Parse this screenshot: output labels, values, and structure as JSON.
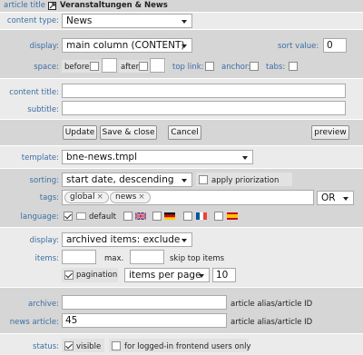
{
  "header": {
    "label": "article title",
    "title": "Veranstaltungen & News"
  },
  "content_type": {
    "label": "content type:",
    "value": "News"
  },
  "display": {
    "label": "display:",
    "value": "main column (CONTENT)",
    "sort_label": "sort value:",
    "sort_value": "0"
  },
  "space": {
    "label": "space:",
    "before": "before",
    "after": "after",
    "top_link": "top link:",
    "anchor": "anchor:",
    "tabs": "tabs:"
  },
  "content_title": {
    "label": "content title:",
    "value": ""
  },
  "subtitle": {
    "label": "subtitle:",
    "value": ""
  },
  "buttons": {
    "update": "Update",
    "save_close": "Save & close",
    "cancel": "Cancel",
    "preview": "preview"
  },
  "template": {
    "label": "template:",
    "value": "bne-news.tmpl"
  },
  "sorting": {
    "label": "sorting:",
    "value": "start date, descending",
    "apply_prio": "apply priorization"
  },
  "tags": {
    "label": "tags:",
    "items": [
      "global",
      "news"
    ],
    "operator": "OR"
  },
  "language": {
    "label": "language:",
    "default_label": "default"
  },
  "display2": {
    "label": "display:",
    "value": "archived items: exclude"
  },
  "items": {
    "label": "items:",
    "max_label": "max.",
    "skip_label": "skip top items"
  },
  "pagination": {
    "label": "pagination",
    "mode": "items per page",
    "count": "10"
  },
  "archive": {
    "label": "archive:",
    "value": "",
    "hint": "article alias/article ID"
  },
  "news_article": {
    "label": "news article:",
    "value": "45",
    "hint": "article alias/article ID"
  },
  "status": {
    "label": "status:",
    "visible": "visible",
    "logged_in": "for logged-in frontend users only"
  }
}
